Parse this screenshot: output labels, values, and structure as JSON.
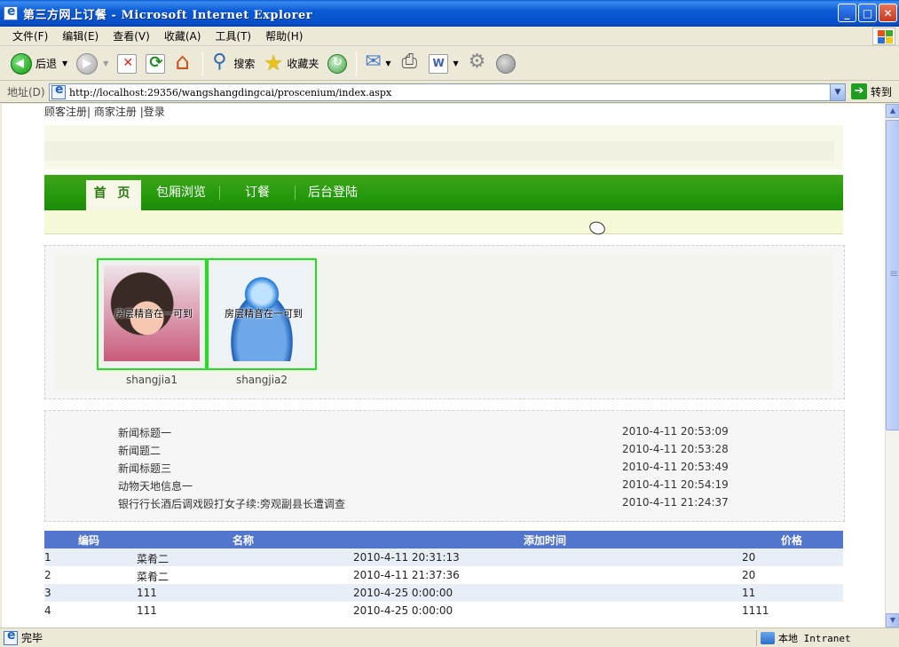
{
  "window": {
    "title": "第三方网上订餐 - Microsoft Internet Explorer",
    "min": "_",
    "max": "□",
    "close": "✕"
  },
  "menu": [
    "文件(F)",
    "编辑(E)",
    "查看(V)",
    "收藏(A)",
    "工具(T)",
    "帮助(H)"
  ],
  "toolbar": {
    "back": "后退",
    "search": "搜索",
    "favorites": "收藏夹"
  },
  "address": {
    "label": "地址(D)",
    "url": "http://localhost:29356/wangshangdingcai/proscenium/index.aspx",
    "go": "转到"
  },
  "toplinks": {
    "customer_register": "顾客注册|",
    "merchant_register": " 商家注册 ",
    "login": " |登录"
  },
  "nav": {
    "tabs": [
      "首 页",
      "包厢浏览",
      "订餐",
      "后台登陆"
    ],
    "active": 0
  },
  "shops": [
    {
      "name": "shangjia1",
      "overlay": "房层精音在一可到"
    },
    {
      "name": "shangjia2",
      "overlay": "房层精音在一可到"
    }
  ],
  "news": [
    {
      "title": "新闻标题一",
      "time": "2010-4-11 20:53:09"
    },
    {
      "title": "新闻题二",
      "time": "2010-4-11 20:53:28"
    },
    {
      "title": "新闻标题三",
      "time": "2010-4-11 20:53:49"
    },
    {
      "title": "动物天地信息一",
      "time": "2010-4-11 20:54:19"
    },
    {
      "title": "银行行长酒后调戏殴打女子续:旁观副县长遭调查",
      "time": "2010-4-11 21:24:37"
    }
  ],
  "table": {
    "headers": [
      "编码",
      "名称",
      "添加时间",
      "价格"
    ],
    "rows": [
      [
        "1",
        "菜肴二",
        "2010-4-11 20:31:13",
        "20"
      ],
      [
        "2",
        "菜肴二",
        "2010-4-11 21:37:36",
        "20"
      ],
      [
        "3",
        "111",
        "2010-4-25 0:00:00",
        "11"
      ],
      [
        "4",
        "111",
        "2010-4-25 0:00:00",
        "1111"
      ]
    ]
  },
  "status": {
    "text": "完毕",
    "zone": "本地 Intranet"
  }
}
